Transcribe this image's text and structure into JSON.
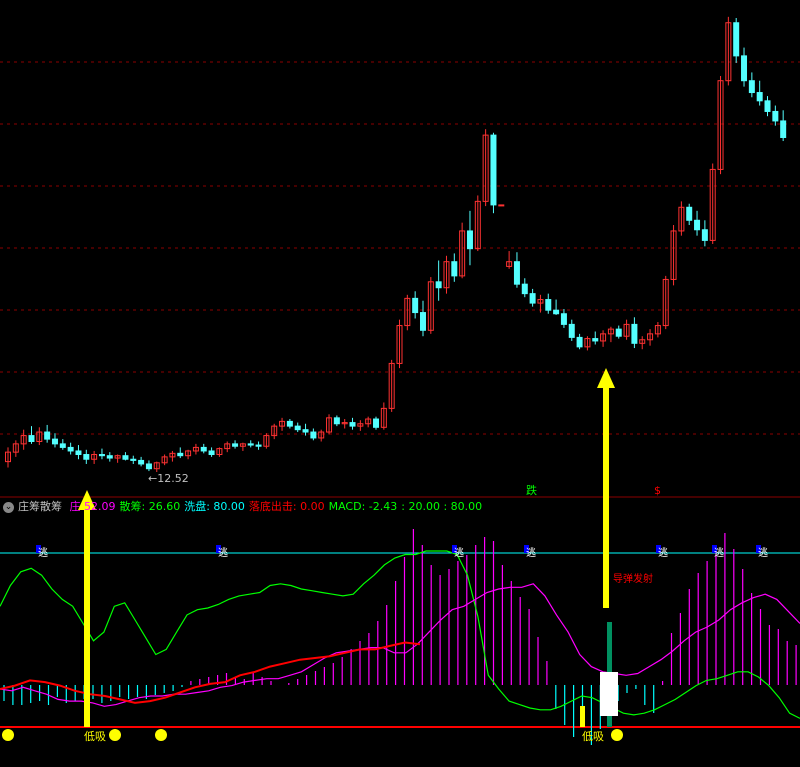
{
  "colors": {
    "up": "#ff3232",
    "down": "#54ffff",
    "grid": "#8b0000",
    "white": "#ffffff",
    "yellow": "#ffff00",
    "magenta": "#ff00ff",
    "green": "#00ff00",
    "cyan": "#00ffff",
    "red": "#ff0000"
  },
  "indicator": {
    "name": "庄筹散筹",
    "items": [
      {
        "label": "庄",
        "value": "52.09",
        "color": "#ff00ff"
      },
      {
        "label": "散筹:",
        "value": "26.60",
        "color": "#00ff00"
      },
      {
        "label": "洗盘:",
        "value": "80.00",
        "color": "#00ffff"
      },
      {
        "label": "落底出击:",
        "value": "0.00",
        "color": "#ff0000"
      },
      {
        "label": "MACD:",
        "value": "-2.43",
        "color": "#00ff00"
      },
      {
        "label": ":",
        "value": "20.00 : 80.00",
        "color": "#00ff00"
      }
    ]
  },
  "annotations": {
    "low_price": "←12.52",
    "fall_label": "跌",
    "dollar_label": "$",
    "escape_label": "逃",
    "missile_label": "导弹发射",
    "low_buy_label": "低吸",
    "smiley": "☻"
  },
  "chart_data": {
    "type": "candlestick",
    "price_panel": {
      "ylim": [
        11,
        52
      ],
      "min_label": 12.52,
      "candles": [
        {
          "o": 13.4,
          "h": 14.6,
          "l": 12.9,
          "c": 14.2
        },
        {
          "o": 14.2,
          "h": 15.2,
          "l": 13.8,
          "c": 14.9
        },
        {
          "o": 14.9,
          "h": 16.1,
          "l": 14.4,
          "c": 15.6
        },
        {
          "o": 15.6,
          "h": 16.4,
          "l": 14.9,
          "c": 15.1
        },
        {
          "o": 15.1,
          "h": 16.3,
          "l": 14.8,
          "c": 15.9
        },
        {
          "o": 15.9,
          "h": 16.5,
          "l": 15.0,
          "c": 15.3
        },
        {
          "o": 15.3,
          "h": 15.8,
          "l": 14.6,
          "c": 14.9
        },
        {
          "o": 14.9,
          "h": 15.3,
          "l": 14.4,
          "c": 14.6
        },
        {
          "o": 14.6,
          "h": 15.0,
          "l": 14.0,
          "c": 14.3
        },
        {
          "o": 14.3,
          "h": 14.8,
          "l": 13.6,
          "c": 14.0
        },
        {
          "o": 14.0,
          "h": 14.4,
          "l": 13.2,
          "c": 13.6
        },
        {
          "o": 13.6,
          "h": 14.3,
          "l": 13.2,
          "c": 14.0
        },
        {
          "o": 14.0,
          "h": 14.5,
          "l": 13.6,
          "c": 13.9
        },
        {
          "o": 13.9,
          "h": 14.2,
          "l": 13.4,
          "c": 13.7
        },
        {
          "o": 13.7,
          "h": 14.0,
          "l": 13.3,
          "c": 13.9
        },
        {
          "o": 13.9,
          "h": 14.2,
          "l": 13.5,
          "c": 13.6
        },
        {
          "o": 13.6,
          "h": 13.9,
          "l": 13.2,
          "c": 13.5
        },
        {
          "o": 13.5,
          "h": 13.8,
          "l": 13.0,
          "c": 13.2
        },
        {
          "o": 13.2,
          "h": 13.5,
          "l": 12.6,
          "c": 12.8
        },
        {
          "o": 12.8,
          "h": 13.4,
          "l": 12.52,
          "c": 13.3
        },
        {
          "o": 13.3,
          "h": 14.0,
          "l": 13.1,
          "c": 13.8
        },
        {
          "o": 13.8,
          "h": 14.3,
          "l": 13.4,
          "c": 14.1
        },
        {
          "o": 14.1,
          "h": 14.6,
          "l": 13.7,
          "c": 13.9
        },
        {
          "o": 13.9,
          "h": 14.4,
          "l": 13.6,
          "c": 14.3
        },
        {
          "o": 14.3,
          "h": 14.9,
          "l": 14.0,
          "c": 14.6
        },
        {
          "o": 14.6,
          "h": 14.9,
          "l": 14.1,
          "c": 14.3
        },
        {
          "o": 14.3,
          "h": 14.6,
          "l": 13.8,
          "c": 14.0
        },
        {
          "o": 14.0,
          "h": 14.6,
          "l": 13.8,
          "c": 14.5
        },
        {
          "o": 14.5,
          "h": 15.1,
          "l": 14.2,
          "c": 14.9
        },
        {
          "o": 14.9,
          "h": 15.2,
          "l": 14.5,
          "c": 14.7
        },
        {
          "o": 14.7,
          "h": 15.0,
          "l": 14.3,
          "c": 14.9
        },
        {
          "o": 14.9,
          "h": 15.2,
          "l": 14.6,
          "c": 14.8
        },
        {
          "o": 14.8,
          "h": 15.1,
          "l": 14.4,
          "c": 14.7
        },
        {
          "o": 14.7,
          "h": 15.8,
          "l": 14.5,
          "c": 15.6
        },
        {
          "o": 15.6,
          "h": 16.6,
          "l": 15.3,
          "c": 16.4
        },
        {
          "o": 16.4,
          "h": 17.1,
          "l": 16.0,
          "c": 16.8
        },
        {
          "o": 16.8,
          "h": 17.0,
          "l": 16.2,
          "c": 16.4
        },
        {
          "o": 16.4,
          "h": 16.7,
          "l": 15.9,
          "c": 16.1
        },
        {
          "o": 16.1,
          "h": 16.6,
          "l": 15.6,
          "c": 15.9
        },
        {
          "o": 15.9,
          "h": 16.2,
          "l": 15.2,
          "c": 15.4
        },
        {
          "o": 15.4,
          "h": 16.1,
          "l": 15.1,
          "c": 15.9
        },
        {
          "o": 15.9,
          "h": 17.4,
          "l": 15.7,
          "c": 17.1
        },
        {
          "o": 17.1,
          "h": 17.3,
          "l": 16.4,
          "c": 16.6
        },
        {
          "o": 16.6,
          "h": 17.0,
          "l": 16.2,
          "c": 16.7
        },
        {
          "o": 16.7,
          "h": 17.1,
          "l": 16.1,
          "c": 16.4
        },
        {
          "o": 16.4,
          "h": 16.9,
          "l": 16.0,
          "c": 16.6
        },
        {
          "o": 16.6,
          "h": 17.2,
          "l": 16.3,
          "c": 17.0
        },
        {
          "o": 17.0,
          "h": 17.2,
          "l": 16.1,
          "c": 16.3
        },
        {
          "o": 16.3,
          "h": 18.4,
          "l": 16.1,
          "c": 17.9
        },
        {
          "o": 17.9,
          "h": 22.0,
          "l": 17.6,
          "c": 21.7
        },
        {
          "o": 21.7,
          "h": 25.4,
          "l": 21.3,
          "c": 24.9
        },
        {
          "o": 24.9,
          "h": 27.5,
          "l": 24.5,
          "c": 27.2
        },
        {
          "o": 27.2,
          "h": 27.8,
          "l": 25.5,
          "c": 26.0
        },
        {
          "o": 26.0,
          "h": 27.0,
          "l": 24.0,
          "c": 24.5
        },
        {
          "o": 24.5,
          "h": 29.0,
          "l": 24.2,
          "c": 28.6
        },
        {
          "o": 28.6,
          "h": 30.4,
          "l": 27.0,
          "c": 28.1
        },
        {
          "o": 28.1,
          "h": 30.8,
          "l": 27.6,
          "c": 30.3
        },
        {
          "o": 30.3,
          "h": 31.0,
          "l": 28.6,
          "c": 29.1
        },
        {
          "o": 29.1,
          "h": 33.6,
          "l": 28.9,
          "c": 32.9
        },
        {
          "o": 32.9,
          "h": 34.6,
          "l": 30.0,
          "c": 31.4
        },
        {
          "o": 31.4,
          "h": 35.9,
          "l": 31.2,
          "c": 35.4
        },
        {
          "o": 35.4,
          "h": 41.5,
          "l": 35.0,
          "c": 41.0
        },
        {
          "o": 41.0,
          "h": 41.2,
          "l": 34.4,
          "c": 35.1
        },
        {
          "o": 35.1,
          "h": 33.0,
          "l": 33.0,
          "c": 35.1
        },
        {
          "o": 29.9,
          "h": 31.2,
          "l": 29.7,
          "c": 30.3
        },
        {
          "o": 30.3,
          "h": 31.1,
          "l": 28.1,
          "c": 28.4
        },
        {
          "o": 28.4,
          "h": 28.9,
          "l": 27.3,
          "c": 27.6
        },
        {
          "o": 27.6,
          "h": 28.0,
          "l": 26.5,
          "c": 26.8
        },
        {
          "o": 26.8,
          "h": 27.5,
          "l": 26.0,
          "c": 27.1
        },
        {
          "o": 27.1,
          "h": 27.6,
          "l": 25.9,
          "c": 26.2
        },
        {
          "o": 26.2,
          "h": 27.1,
          "l": 25.8,
          "c": 25.9
        },
        {
          "o": 25.9,
          "h": 26.3,
          "l": 24.7,
          "c": 25.0
        },
        {
          "o": 25.0,
          "h": 25.4,
          "l": 23.6,
          "c": 23.9
        },
        {
          "o": 23.9,
          "h": 24.2,
          "l": 22.9,
          "c": 23.1
        },
        {
          "o": 23.1,
          "h": 24.0,
          "l": 22.8,
          "c": 23.8
        },
        {
          "o": 23.8,
          "h": 24.4,
          "l": 23.3,
          "c": 23.6
        },
        {
          "o": 23.6,
          "h": 24.5,
          "l": 23.1,
          "c": 24.2
        },
        {
          "o": 24.2,
          "h": 24.8,
          "l": 23.5,
          "c": 24.6
        },
        {
          "o": 24.6,
          "h": 24.9,
          "l": 23.8,
          "c": 24.0
        },
        {
          "o": 24.0,
          "h": 25.4,
          "l": 23.7,
          "c": 25.0
        },
        {
          "o": 25.0,
          "h": 25.6,
          "l": 23.0,
          "c": 23.4
        },
        {
          "o": 23.4,
          "h": 24.0,
          "l": 22.9,
          "c": 23.7
        },
        {
          "o": 23.7,
          "h": 24.6,
          "l": 23.2,
          "c": 24.2
        },
        {
          "o": 24.2,
          "h": 25.2,
          "l": 23.9,
          "c": 24.9
        },
        {
          "o": 24.9,
          "h": 29.1,
          "l": 24.6,
          "c": 28.8
        },
        {
          "o": 28.8,
          "h": 33.4,
          "l": 28.3,
          "c": 32.9
        },
        {
          "o": 32.9,
          "h": 35.4,
          "l": 32.5,
          "c": 34.9
        },
        {
          "o": 34.9,
          "h": 35.2,
          "l": 33.4,
          "c": 33.8
        },
        {
          "o": 33.8,
          "h": 34.6,
          "l": 32.5,
          "c": 33.0
        },
        {
          "o": 33.0,
          "h": 33.8,
          "l": 31.6,
          "c": 32.1
        },
        {
          "o": 32.1,
          "h": 38.6,
          "l": 31.8,
          "c": 38.1
        },
        {
          "o": 38.1,
          "h": 46.0,
          "l": 37.7,
          "c": 45.6
        },
        {
          "o": 45.6,
          "h": 51.0,
          "l": 45.2,
          "c": 50.5
        },
        {
          "o": 50.5,
          "h": 50.9,
          "l": 47.1,
          "c": 47.7
        },
        {
          "o": 47.7,
          "h": 48.4,
          "l": 45.1,
          "c": 45.6
        },
        {
          "o": 45.6,
          "h": 46.3,
          "l": 44.2,
          "c": 44.6
        },
        {
          "o": 44.6,
          "h": 45.6,
          "l": 43.5,
          "c": 43.9
        },
        {
          "o": 43.9,
          "h": 44.3,
          "l": 42.6,
          "c": 43.0
        },
        {
          "o": 43.0,
          "h": 43.5,
          "l": 41.8,
          "c": 42.2
        },
        {
          "o": 42.2,
          "h": 43.1,
          "l": 40.5,
          "c": 40.8
        }
      ]
    },
    "indicator_panel": {
      "ylim": [
        -10,
        110
      ],
      "green_line": [
        60,
        72,
        80,
        82,
        78,
        70,
        64,
        60,
        50,
        40,
        45,
        60,
        62,
        52,
        42,
        32,
        35,
        45,
        55,
        58,
        59,
        61,
        64,
        66,
        67,
        68,
        72,
        73,
        72,
        70,
        69,
        68,
        67,
        66,
        67,
        73,
        78,
        84,
        88,
        90,
        90,
        92,
        92,
        92,
        90,
        78,
        54,
        20,
        12,
        5,
        3,
        1,
        0,
        0,
        2,
        5,
        8,
        7,
        4,
        1,
        -2,
        -3,
        -2,
        0,
        3,
        6,
        10,
        14,
        17,
        18,
        20,
        22,
        22,
        19,
        14,
        7,
        -2,
        -5
      ],
      "magenta_line": [
        12,
        11,
        13,
        11,
        9,
        6,
        5,
        5,
        4,
        2,
        3,
        5,
        7,
        8,
        8,
        9,
        9,
        10,
        11,
        13,
        14,
        16,
        17,
        18,
        18,
        20,
        22,
        26,
        30,
        33,
        34,
        35,
        36,
        36,
        33,
        33,
        38,
        45,
        52,
        58,
        60,
        64,
        68,
        70,
        71,
        71,
        73,
        66,
        55,
        45,
        32,
        25,
        22,
        21,
        20,
        21,
        25,
        29,
        34,
        40,
        45,
        48,
        52,
        58,
        62,
        65,
        67,
        64,
        57,
        50
      ],
      "red_line": [
        12,
        14,
        17,
        16,
        14,
        11,
        9,
        8,
        6,
        4,
        5,
        7,
        10,
        13,
        15,
        16,
        20,
        22,
        25,
        27,
        29,
        30,
        31,
        33,
        35,
        35,
        37,
        39,
        38
      ],
      "hist": [
        -8,
        -10,
        -10,
        -9,
        -8,
        -10,
        -6,
        -9,
        -8,
        -7,
        -7,
        -9,
        -8,
        -6,
        -7,
        -6,
        -7,
        -5,
        -4,
        -3,
        -1,
        2,
        3,
        4,
        5,
        6,
        4,
        3,
        6,
        4,
        2,
        0,
        1,
        3,
        5,
        7,
        9,
        11,
        14,
        18,
        22,
        26,
        32,
        40,
        52,
        64,
        78,
        70,
        60,
        55,
        58,
        62,
        65,
        70,
        74,
        72,
        60,
        52,
        44,
        38,
        24,
        12,
        -12,
        -20,
        -26,
        -18,
        -30,
        -22,
        -15,
        -8,
        -4,
        -2,
        -10,
        -14,
        2,
        26,
        36,
        48,
        56,
        62,
        70,
        76,
        68,
        58,
        46,
        38,
        30,
        28,
        22,
        20
      ]
    }
  }
}
